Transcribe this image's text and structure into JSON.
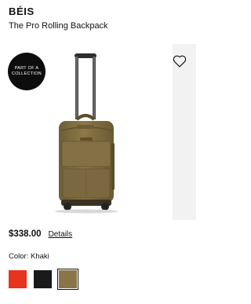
{
  "brand": "BÉIS",
  "product": {
    "title": "The Pro Rolling Backpack",
    "badge": "PART OF A\nCOLLECTION",
    "price": "$338.00",
    "details_label": "Details",
    "color_label": "Color: Khaki",
    "image_name": "rolling-backpack-khaki"
  },
  "swatches": [
    {
      "name": "Red",
      "color": "#e8331f",
      "selected": false
    },
    {
      "name": "Black",
      "color": "#1a1a1a",
      "selected": false
    },
    {
      "name": "Khaki",
      "color": "#8a7548",
      "selected": true
    }
  ],
  "icons": {
    "wishlist": "heart-icon"
  }
}
